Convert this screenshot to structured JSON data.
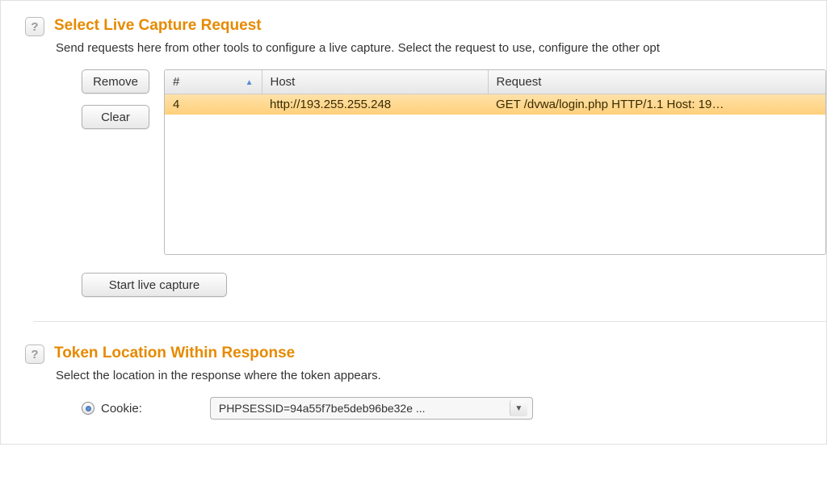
{
  "section1": {
    "title": "Select Live Capture Request",
    "desc": "Send requests here from other tools to configure a live capture. Select the request to use, configure the other opt",
    "buttons": {
      "remove": "Remove",
      "clear": "Clear",
      "start": "Start live capture"
    },
    "table": {
      "headers": {
        "num": "#",
        "host": "Host",
        "request": "Request"
      },
      "rows": [
        {
          "num": "4",
          "host": "http://193.255.255.248",
          "request": "GET /dvwa/login.php HTTP/1.1  Host: 19…"
        }
      ]
    }
  },
  "section2": {
    "title": "Token Location Within Response",
    "desc": "Select the location in the response where the token appears.",
    "radio": {
      "cookie_label": "Cookie:"
    },
    "combo_value": "PHPSESSID=94a55f7be5deb96be32e ..."
  },
  "icons": {
    "help": "?"
  }
}
